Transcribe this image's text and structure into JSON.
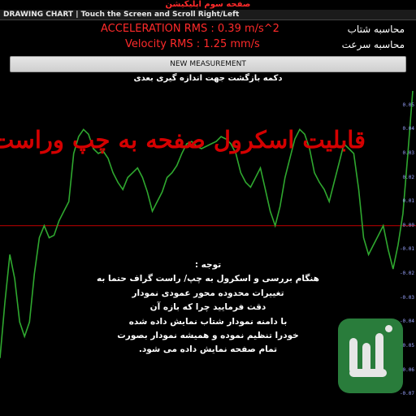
{
  "top_caption": "صفحه سوم اپلیکیشن",
  "titlebar": {
    "title": "DRAWING CHART | Touch the Screen and Scroll Right/Left"
  },
  "metrics": {
    "acceleration_value": "ACCELERATION RMS : 0.39 m/s^2",
    "acceleration_label": "محاسبه شتاب",
    "velocity_value": "Velocity RMS : 1.25  mm/s",
    "velocity_label": "محاسبه سرعت"
  },
  "buttons": {
    "new_measurement": "NEW MEASUREMENT"
  },
  "back_hint": "دکمه بازگشت جهت اندازه گیری بعدی",
  "overlay": {
    "scroll_title": "قابلیت اسکرول صفحه به چپ وراست",
    "note_lines": [
      "توجه :",
      "هنگام بررسی  و اسکرول به چپ/ راست گراف حتما به",
      "تغییرات محدوده محور عمودی نمودار",
      "دقت فرمایید چرا که بازه آن",
      "با دامنه نمودار شتاب نمایش داده شده",
      "خودرا تنظیم نموده و همیشه نمودار بصورت",
      "تمام صفحه نمایش داده می شود."
    ]
  },
  "colors": {
    "background": "#000000",
    "accent_red": "#ff2a2a",
    "series_green": "#2fa82f",
    "tick_blue": "#9aa4ff",
    "baseline_red": "#c40000"
  },
  "chart_data": {
    "type": "line",
    "ylabel": "",
    "xlabel": "",
    "y_ticks": [
      "0.05",
      "0.04",
      "0.03",
      "0.02",
      "0.01",
      "0.00",
      "-0.01",
      "-0.02",
      "-0.03",
      "-0.04",
      "-0.05",
      "-0.06",
      "-0.07"
    ],
    "ylim": [
      -0.075,
      0.06
    ],
    "series": [
      {
        "values": [
          -0.055,
          -0.032,
          -0.012,
          -0.022,
          -0.04,
          -0.046,
          -0.04,
          -0.02,
          -0.005,
          0.0,
          -0.005,
          -0.004,
          0.002,
          0.006,
          0.01,
          0.03,
          0.037,
          0.04,
          0.038,
          0.032,
          0.03,
          0.031,
          0.028,
          0.022,
          0.018,
          0.015,
          0.02,
          0.022,
          0.024,
          0.02,
          0.014,
          0.006,
          0.01,
          0.014,
          0.02,
          0.022,
          0.025,
          0.03,
          0.034,
          0.035,
          0.033,
          0.032,
          0.033,
          0.034,
          0.035,
          0.037,
          0.036,
          0.034,
          0.03,
          0.022,
          0.018,
          0.016,
          0.02,
          0.024,
          0.015,
          0.006,
          0.0,
          0.008,
          0.02,
          0.028,
          0.036,
          0.04,
          0.038,
          0.032,
          0.022,
          0.018,
          0.015,
          0.01,
          0.018,
          0.026,
          0.034,
          0.032,
          0.03,
          0.015,
          -0.005,
          -0.012,
          -0.008,
          -0.004,
          0.0,
          -0.01,
          -0.018,
          -0.008,
          0.005,
          0.03,
          0.056
        ]
      }
    ]
  }
}
